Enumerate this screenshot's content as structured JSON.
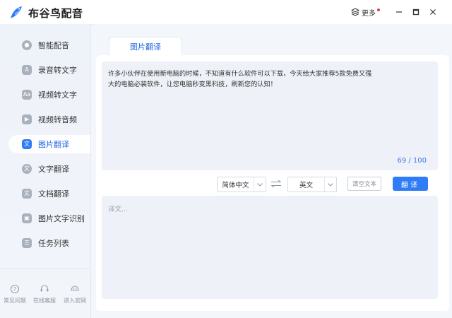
{
  "app": {
    "title": "布谷鸟配音",
    "more_label": "更多",
    "brand_color": "#2f7cf6",
    "alert_dot_color": "#e6393d"
  },
  "window_controls": [
    "minimize-icon",
    "maximize-icon",
    "close-icon"
  ],
  "sidebar": {
    "items": [
      {
        "label": "智能配音",
        "icon": "smart-dub-icon",
        "active": false
      },
      {
        "label": "录音转文字",
        "icon": "audio-to-text-icon",
        "active": false
      },
      {
        "label": "视频转文字",
        "icon": "video-to-text-icon",
        "active": false
      },
      {
        "label": "视频转音频",
        "icon": "video-to-audio-icon",
        "active": false
      },
      {
        "label": "图片翻译",
        "icon": "image-translate-icon",
        "active": true
      },
      {
        "label": "文字翻译",
        "icon": "text-translate-icon",
        "active": false
      },
      {
        "label": "文档翻译",
        "icon": "document-translate-icon",
        "active": false
      },
      {
        "label": "图片文字识别",
        "icon": "image-ocr-icon",
        "active": false
      },
      {
        "label": "任务列表",
        "icon": "task-list-icon",
        "active": false
      }
    ],
    "footer": [
      {
        "label": "常见问题",
        "icon": "help-icon"
      },
      {
        "label": "在线客服",
        "icon": "support-icon"
      },
      {
        "label": "进入官网",
        "icon": "website-icon"
      }
    ]
  },
  "main": {
    "tab_label": "图片翻译",
    "source_text": "许多小伙伴在使用新电脑的时候，不知道有什么软件可以下载，今天给大家推荐5款免费又强大的电脑必装软件，让您电脑秒变黑科技，刷新您的认知！",
    "char_count": "69 / 100",
    "source_lang": "简体中文",
    "target_lang": "英文",
    "clear_label": "清空文本",
    "translate_label": "翻译",
    "result_placeholder": "译文..."
  }
}
